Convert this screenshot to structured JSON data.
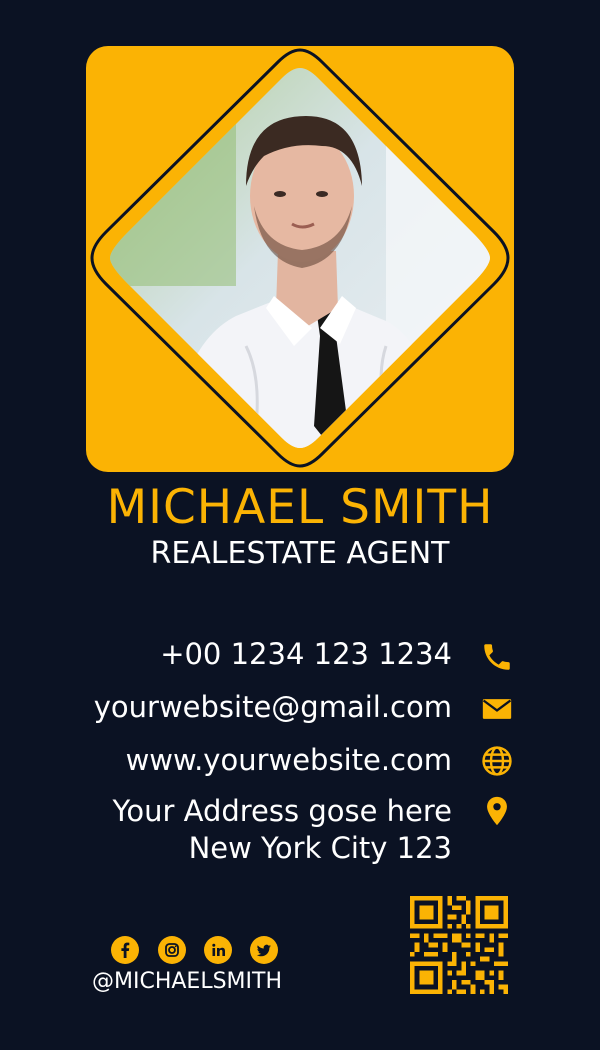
{
  "profile": {
    "name": "MICHAEL SMITH",
    "title": "REALESTATE AGENT"
  },
  "contacts": {
    "phone": "+00 1234 123 1234",
    "email": "yourwebsite@gmail.com",
    "website": "www.yourwebsite.com",
    "address_line1": "Your Address gose here",
    "address_line2": "New York City 123"
  },
  "social": {
    "handle": "@MICHAELSMITH",
    "icons": [
      "facebook-icon",
      "instagram-icon",
      "linkedin-icon",
      "twitter-icon"
    ]
  },
  "colors": {
    "background": "#0b1223",
    "accent": "#fbb304",
    "text": "#ffffff"
  }
}
